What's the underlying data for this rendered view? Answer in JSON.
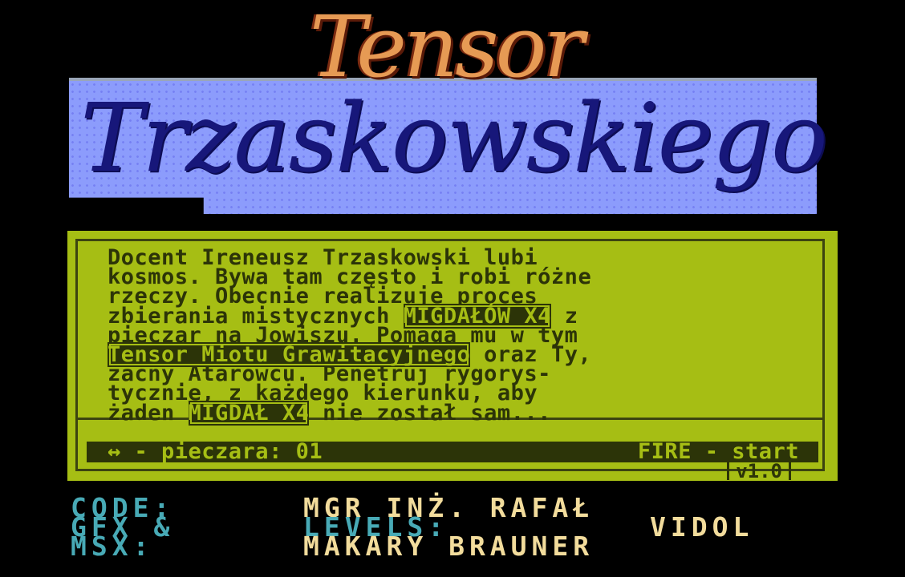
{
  "logo": {
    "title_top": "Tensor",
    "title_main": "Trzaskowskiego"
  },
  "story": {
    "line1": "Docent Ireneusz Trzaskowski lubi",
    "line2": "kosmos. Bywa tam często i robi różne",
    "line3": "rzeczy. Obecnie realizuje proces",
    "line4a": "zbierania mistycznych ",
    "line4hl": "MIGDAŁÓW X4",
    "line4b": " z",
    "line5": "pieczar na Jowiszu. Pomaga mu w tym",
    "line6hl": "Tensor Miotu Grawitacyjnego",
    "line6b": " oraz Ty,",
    "line7": "zacny Atarowcu. Penetruj rygorys-",
    "line8": "tycznie, z każdego kierunku, aby",
    "line9a": "żaden ",
    "line9hl": "MIGDAŁ X4",
    "line9b": " nie został sam..."
  },
  "status": {
    "left": "↔ - pieczara: 01",
    "right": "FIRE - start"
  },
  "version": "v1.0",
  "credits": {
    "code_label": "CODE:",
    "code_value": "MGR INŻ. RAFAŁ",
    "gfx_label": "GFX &",
    "levels_label": "LEVELS:",
    "gfx_value": "VIDOL",
    "msx_label": "MSX:",
    "msx_value": "MAKARY BRAUNER"
  },
  "colors": {
    "background": "#000000",
    "panel": "#a6be14",
    "panel_dark": "#2c3408",
    "logo_plate": "#8c9cfc",
    "logo_text": "#17177a",
    "logo_orange": "#e69a54",
    "credit_cyan": "#48aab6",
    "credit_cream": "#f2dc9c"
  }
}
